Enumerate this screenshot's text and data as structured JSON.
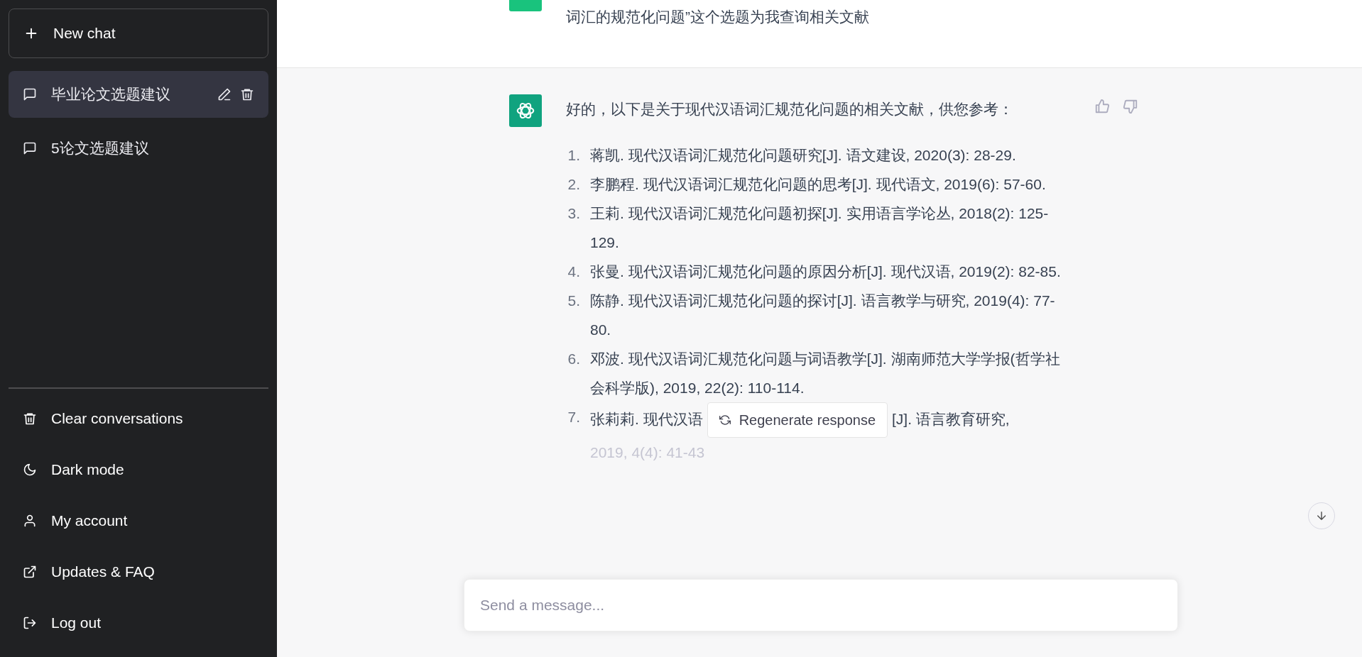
{
  "sidebar": {
    "new_chat": "New chat",
    "conversations": [
      {
        "title": "毕业论文选题建议",
        "selected": true
      },
      {
        "title": "5论文选题建议",
        "selected": false
      }
    ],
    "menu": [
      {
        "kind": "trash",
        "label": "Clear conversations"
      },
      {
        "kind": "moon",
        "label": "Dark mode"
      },
      {
        "kind": "user",
        "label": "My account"
      },
      {
        "kind": "external",
        "label": "Updates & FAQ"
      },
      {
        "kind": "logout",
        "label": "Log out"
      }
    ]
  },
  "chat": {
    "user_message": "词汇的规范化问题”这个选题为我查询相关文献",
    "reply": {
      "intro": "好的，以下是关于现代汉语词汇规范化问题的相关文献，供您参考：",
      "references": [
        {
          "number": "1.",
          "kind": "full",
          "text": "蒋凯. 现代汉语词汇规范化问题研究[J]. 语文建设, 2020(3): 28-29."
        },
        {
          "number": "2.",
          "kind": "full",
          "text": "李鹏程. 现代汉语词汇规范化问题的思考[J]. 现代语文, 2019(6): 57-60."
        },
        {
          "number": "3.",
          "kind": "full",
          "text": "王莉. 现代汉语词汇规范化问题初探[J]. 实用语言学论丛, 2018(2): 125-129."
        },
        {
          "number": "4.",
          "kind": "full",
          "text": "张曼. 现代汉语词汇规范化问题的原因分析[J]. 现代汉语, 2019(2): 82-85."
        },
        {
          "number": "5.",
          "kind": "full",
          "text": "陈静. 现代汉语词汇规范化问题的探讨[J]. 语言教学与研究, 2019(4): 77-80."
        },
        {
          "number": "6.",
          "kind": "full",
          "text": "邓波. 现代汉语词汇规范化问题与词语教学[J]. 湖南师范大学学报(哲学社会科学版), 2019, 22(2): 110-114."
        },
        {
          "number": "7.",
          "kind": "covered",
          "fragments": [
            "张莉莉. 现代汉语",
            "[J]. 语言教育研究,",
            "2019, 4(4): 41-43"
          ]
        }
      ]
    }
  },
  "regenerate": "Regenerate response",
  "composer": {
    "placeholder": "Send a message..."
  }
}
